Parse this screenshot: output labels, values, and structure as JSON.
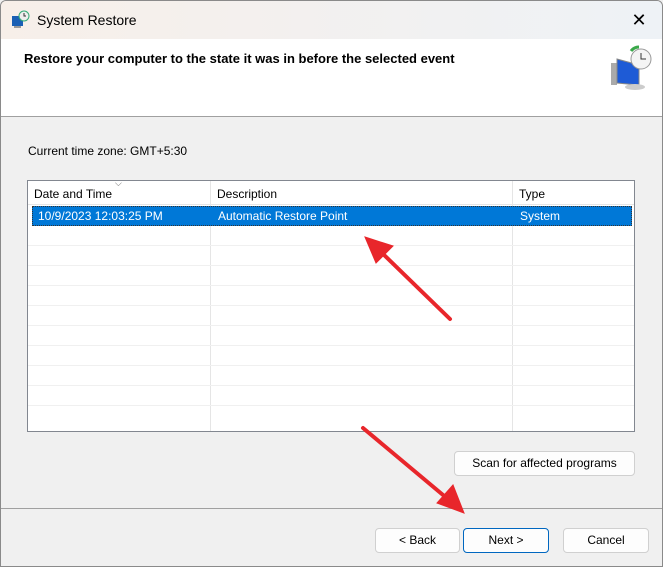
{
  "window": {
    "title": "System Restore",
    "close_glyph": "✕"
  },
  "header": {
    "heading": "Restore your computer to the state it was in before the selected event"
  },
  "timezone": "Current time zone: GMT+5:30",
  "table": {
    "columns": [
      "Date and Time",
      "Description",
      "Type"
    ],
    "rows": [
      {
        "date": "10/9/2023 12:03:25 PM",
        "description": "Automatic Restore Point",
        "type": "System",
        "selected": true
      }
    ]
  },
  "buttons": {
    "scan": "Scan for affected programs",
    "back": "< Back",
    "next": "Next >",
    "cancel": "Cancel"
  },
  "colors": {
    "selection": "#0078d7",
    "arrow": "#e8262b"
  }
}
